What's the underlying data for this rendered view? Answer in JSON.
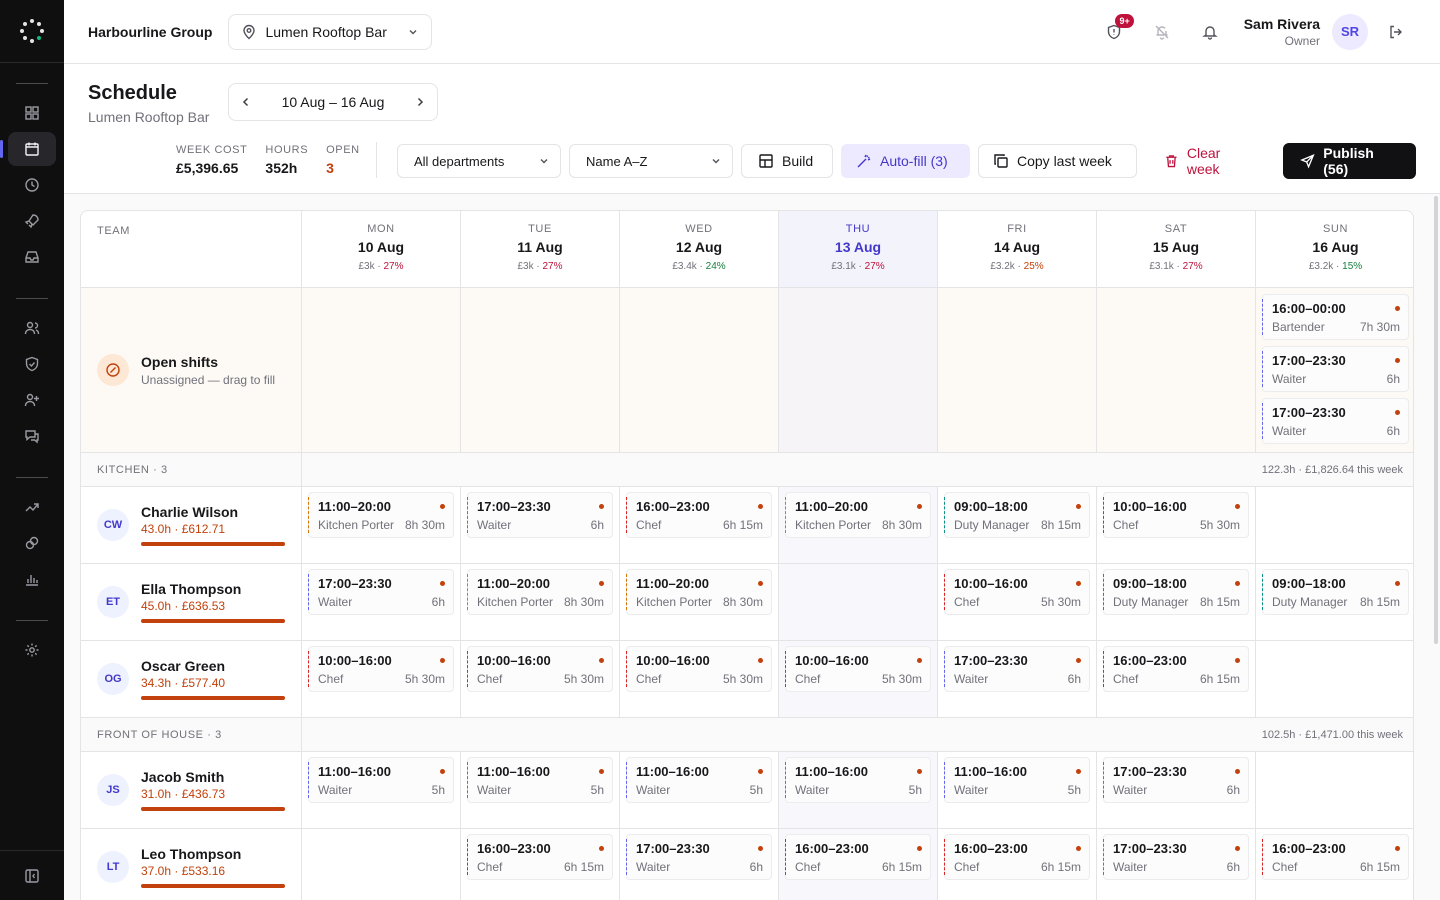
{
  "org": {
    "name": "Harbourline Group"
  },
  "location": {
    "selected": "Lumen Rooftop Bar"
  },
  "notifications": {
    "badge": "9+"
  },
  "user": {
    "name": "Sam Rivera",
    "role": "Owner",
    "initials": "SR"
  },
  "page": {
    "title": "Schedule",
    "subtitle": "Lumen Rooftop Bar",
    "week_range": "10 Aug – 16 Aug"
  },
  "stats": [
    {
      "label": "WEEK COST",
      "value": "£5,396.65"
    },
    {
      "label": "HOURS",
      "value": "352h"
    },
    {
      "label": "OPEN",
      "value": "3"
    }
  ],
  "filters": {
    "department": "All departments",
    "sort": "Name A–Z"
  },
  "actions": {
    "build": "Build",
    "autofill": "Auto-fill (3)",
    "copy": "Copy last week",
    "clear": "Clear week",
    "publish": "Publish (56)"
  },
  "grid": {
    "team_header": "TEAM",
    "days": [
      {
        "name": "MON",
        "date": "10 Aug",
        "cost": "£3k",
        "pct": "27%",
        "pct_color": "red"
      },
      {
        "name": "TUE",
        "date": "11 Aug",
        "cost": "£3k",
        "pct": "27%",
        "pct_color": "red"
      },
      {
        "name": "WED",
        "date": "12 Aug",
        "cost": "£3.4k",
        "pct": "24%",
        "pct_color": "green"
      },
      {
        "name": "THU",
        "date": "13 Aug",
        "cost": "£3.1k",
        "pct": "27%",
        "pct_color": "red"
      },
      {
        "name": "FRI",
        "date": "14 Aug",
        "cost": "£3.2k",
        "pct": "25%",
        "pct_color": "orange"
      },
      {
        "name": "SAT",
        "date": "15 Aug",
        "cost": "£3.1k",
        "pct": "27%",
        "pct_color": "red"
      },
      {
        "name": "SUN",
        "date": "16 Aug",
        "cost": "£3.2k",
        "pct": "15%",
        "pct_color": "green"
      }
    ],
    "open_shifts": {
      "title": "Open shifts",
      "subtitle": "Unassigned — drag to fill",
      "sun": [
        {
          "time": "16:00–00:00",
          "role": "Bartender",
          "duration": "7h 30m"
        },
        {
          "time": "17:00–23:30",
          "role": "Waiter",
          "duration": "6h"
        },
        {
          "time": "17:00–23:30",
          "role": "Waiter",
          "duration": "6h"
        }
      ]
    },
    "sections": [
      {
        "label": "KITCHEN · 3",
        "summary": "122.3h · £1,826.64 this week",
        "employees": [
          {
            "initials": "CW",
            "name": "Charlie Wilson",
            "hours": "43.0h · £612.71",
            "shifts": [
              {
                "time": "11:00–20:00",
                "role": "Kitchen Porter",
                "duration": "8h 30m"
              },
              {
                "time": "17:00–23:30",
                "role": "Waiter",
                "duration": "6h"
              },
              {
                "time": "16:00–23:00",
                "role": "Chef",
                "duration": "6h 15m"
              },
              {
                "time": "11:00–20:00",
                "role": "Kitchen Porter",
                "duration": "8h 30m"
              },
              {
                "time": "09:00–18:00",
                "role": "Duty Manager",
                "duration": "8h 15m"
              },
              {
                "time": "10:00–16:00",
                "role": "Chef",
                "duration": "5h 30m"
              },
              null
            ]
          },
          {
            "initials": "ET",
            "name": "Ella Thompson",
            "hours": "45.0h · £636.53",
            "shifts": [
              {
                "time": "17:00–23:30",
                "role": "Waiter",
                "duration": "6h"
              },
              {
                "time": "11:00–20:00",
                "role": "Kitchen Porter",
                "duration": "8h 30m"
              },
              {
                "time": "11:00–20:00",
                "role": "Kitchen Porter",
                "duration": "8h 30m"
              },
              null,
              {
                "time": "10:00–16:00",
                "role": "Chef",
                "duration": "5h 30m"
              },
              {
                "time": "09:00–18:00",
                "role": "Duty Manager",
                "duration": "8h 15m"
              },
              {
                "time": "09:00–18:00",
                "role": "Duty Manager",
                "duration": "8h 15m"
              }
            ]
          },
          {
            "initials": "OG",
            "name": "Oscar Green",
            "hours": "34.3h · £577.40",
            "shifts": [
              {
                "time": "10:00–16:00",
                "role": "Chef",
                "duration": "5h 30m"
              },
              {
                "time": "10:00–16:00",
                "role": "Chef",
                "duration": "5h 30m"
              },
              {
                "time": "10:00–16:00",
                "role": "Chef",
                "duration": "5h 30m"
              },
              {
                "time": "10:00–16:00",
                "role": "Chef",
                "duration": "5h 30m"
              },
              {
                "time": "17:00–23:30",
                "role": "Waiter",
                "duration": "6h"
              },
              {
                "time": "16:00–23:00",
                "role": "Chef",
                "duration": "6h 15m"
              },
              null
            ]
          }
        ]
      },
      {
        "label": "FRONT OF HOUSE · 3",
        "summary": "102.5h · £1,471.00 this week",
        "employees": [
          {
            "initials": "JS",
            "name": "Jacob Smith",
            "hours": "31.0h · £436.73",
            "shifts": [
              {
                "time": "11:00–16:00",
                "role": "Waiter",
                "duration": "5h"
              },
              {
                "time": "11:00–16:00",
                "role": "Waiter",
                "duration": "5h"
              },
              {
                "time": "11:00–16:00",
                "role": "Waiter",
                "duration": "5h"
              },
              {
                "time": "11:00–16:00",
                "role": "Waiter",
                "duration": "5h"
              },
              {
                "time": "11:00–16:00",
                "role": "Waiter",
                "duration": "5h"
              },
              {
                "time": "17:00–23:30",
                "role": "Waiter",
                "duration": "6h"
              },
              null
            ]
          },
          {
            "initials": "LT",
            "name": "Leo Thompson",
            "hours": "37.0h · £533.16",
            "shifts": [
              null,
              {
                "time": "16:00–23:00",
                "role": "Chef",
                "duration": "6h 15m"
              },
              {
                "time": "17:00–23:30",
                "role": "Waiter",
                "duration": "6h"
              },
              {
                "time": "16:00–23:00",
                "role": "Chef",
                "duration": "6h 15m"
              },
              {
                "time": "16:00–23:00",
                "role": "Chef",
                "duration": "6h 15m"
              },
              {
                "time": "17:00–23:30",
                "role": "Waiter",
                "duration": "6h"
              },
              {
                "time": "16:00–23:00",
                "role": "Chef",
                "duration": "6h 15m"
              }
            ]
          }
        ]
      }
    ]
  }
}
